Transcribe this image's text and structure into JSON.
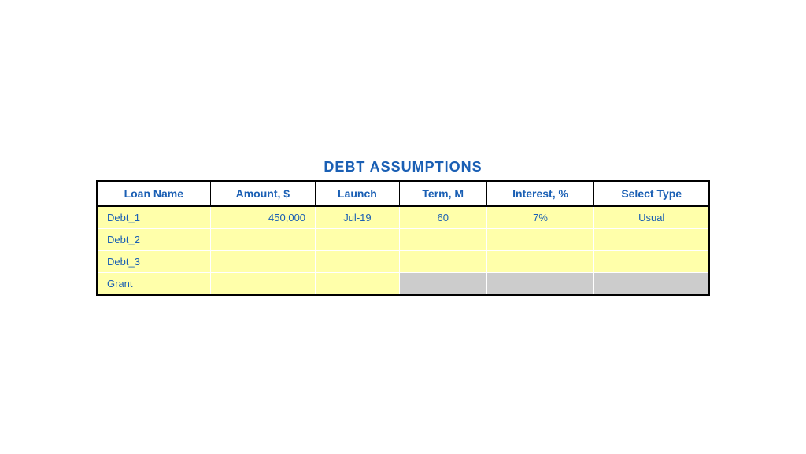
{
  "title": "DEBT ASSUMPTIONS",
  "table": {
    "headers": [
      "Loan Name",
      "Amount, $",
      "Launch",
      "Term, M",
      "Interest, %",
      "Select Type"
    ],
    "rows": [
      {
        "loan_name": "Debt_1",
        "amount": "450,000",
        "launch": "Jul-19",
        "term": "60",
        "interest": "7%",
        "select_type": "Usual",
        "grant_row": false
      },
      {
        "loan_name": "Debt_2",
        "amount": "",
        "launch": "",
        "term": "",
        "interest": "",
        "select_type": "",
        "grant_row": false
      },
      {
        "loan_name": "Debt_3",
        "amount": "",
        "launch": "",
        "term": "",
        "interest": "",
        "select_type": "",
        "grant_row": false
      },
      {
        "loan_name": "Grant",
        "amount": "",
        "launch": "",
        "term": "",
        "interest": "",
        "select_type": "",
        "grant_row": true
      }
    ]
  }
}
